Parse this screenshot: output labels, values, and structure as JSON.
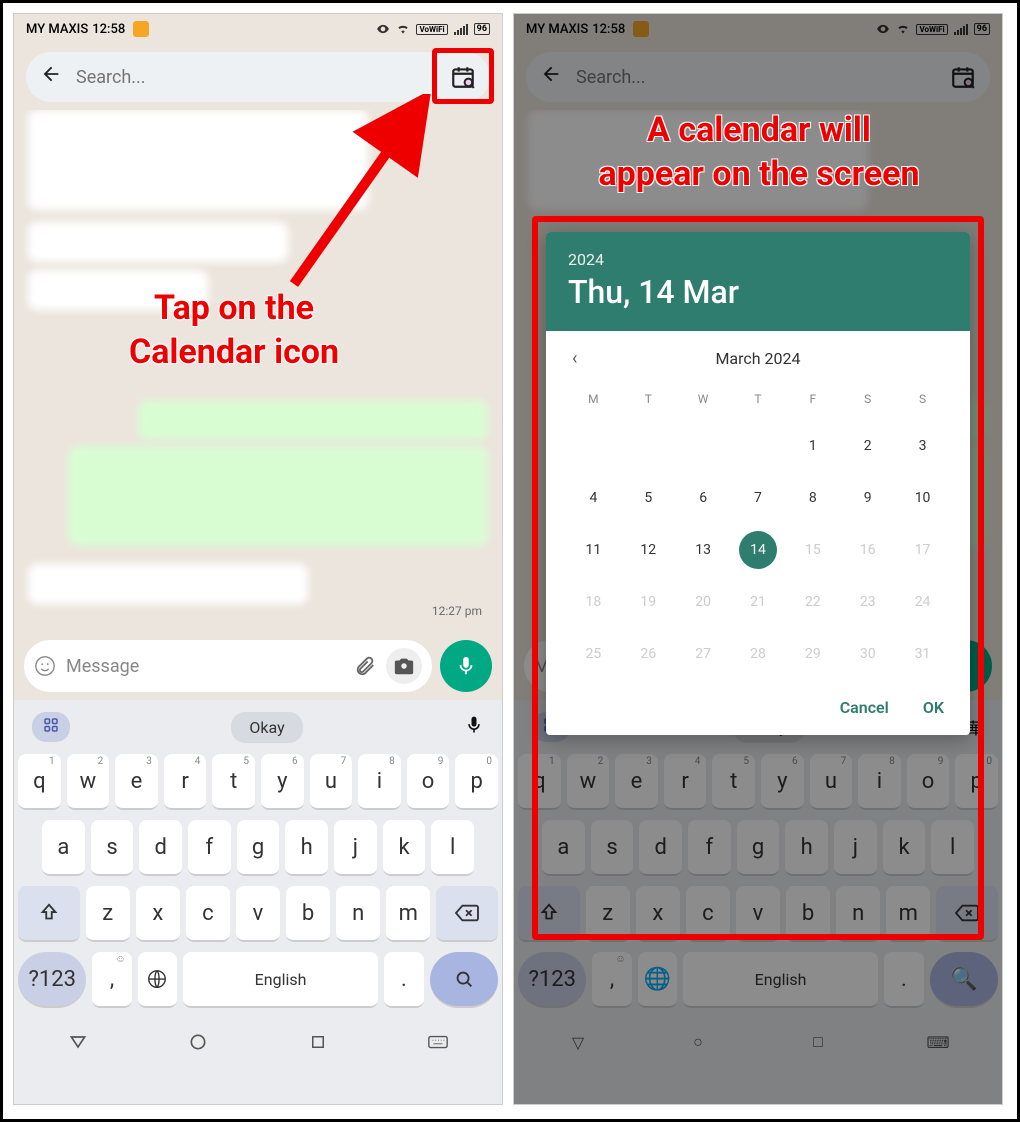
{
  "status": {
    "carrier": "MY MAXIS",
    "time": "12:58",
    "battery": "96",
    "vowifi": "VoWiFi"
  },
  "search": {
    "placeholder": "Search..."
  },
  "chat": {
    "timestamp": "12:27 pm",
    "message_placeholder": "Message"
  },
  "annotations": {
    "left": "Tap on the\nCalendar icon",
    "right": "A calendar will\nappear on the screen"
  },
  "kb": {
    "suggest_center": "Okay",
    "row1": [
      "q",
      "w",
      "e",
      "r",
      "t",
      "y",
      "u",
      "i",
      "o",
      "p"
    ],
    "row1_sup": [
      "1",
      "2",
      "3",
      "4",
      "5",
      "6",
      "7",
      "8",
      "9",
      "0"
    ],
    "row2": [
      "a",
      "s",
      "d",
      "f",
      "g",
      "h",
      "j",
      "k",
      "l"
    ],
    "row3": [
      "z",
      "x",
      "c",
      "v",
      "b",
      "n",
      "m"
    ],
    "symkey": "?123",
    "space": "English",
    "comma": ",",
    "dot": "."
  },
  "calendar": {
    "year": "2024",
    "date_str": "Thu, 14 Mar",
    "month_label": "March 2024",
    "dow": [
      "M",
      "T",
      "W",
      "T",
      "F",
      "S",
      "S"
    ],
    "weeks": [
      [
        "",
        "",
        "",
        "",
        "1",
        "2",
        "3"
      ],
      [
        "4",
        "5",
        "6",
        "7",
        "8",
        "9",
        "10"
      ],
      [
        "11",
        "12",
        "13",
        "14",
        "15",
        "16",
        "17"
      ],
      [
        "18",
        "19",
        "20",
        "21",
        "22",
        "23",
        "24"
      ],
      [
        "25",
        "26",
        "27",
        "28",
        "29",
        "30",
        "31"
      ]
    ],
    "selected": "14",
    "muted_from": 15,
    "cancel": "Cancel",
    "ok": "OK"
  }
}
